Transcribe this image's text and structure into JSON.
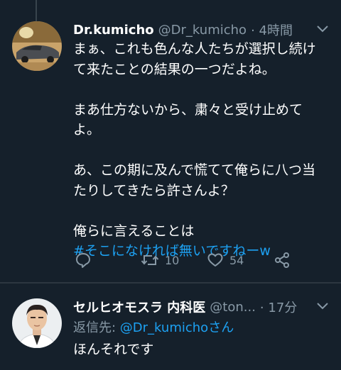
{
  "tweet1": {
    "display_name": "Dr.kumicho",
    "handle": "@Dr_kumicho",
    "time": "· 4時間",
    "paragraphs": [
      [
        "まぁ、これも色んな人たちが選択し続け",
        "て来たことの結果の一つだよね。"
      ],
      [
        "まあ仕方ないから、粛々と受け止めて",
        "よ。"
      ],
      [
        "あ、この期に及んで慌てて俺らに八つ当",
        "たりしてきたら許さんよ？"
      ]
    ],
    "last_line": "俺らに言えることは",
    "hashtag": "#そこになければ無いですねーw",
    "actions": {
      "retweet_count": "10",
      "like_count": "54"
    }
  },
  "tweet2": {
    "display_name": "セルヒオモスラ 内科医",
    "handle": "@ton...",
    "time": "· 17分",
    "reply_prefix": "返信先: ",
    "reply_mention": "@Dr_kumichoさん",
    "text": "ほんそれです"
  },
  "icons": {
    "caret": "chevron-down-icon",
    "reply": "reply-icon",
    "retweet": "retweet-icon",
    "like": "heart-icon",
    "share": "share-icon"
  },
  "colors": {
    "background": "#15202b",
    "muted": "#8899a6",
    "accent": "#1da1f2"
  }
}
